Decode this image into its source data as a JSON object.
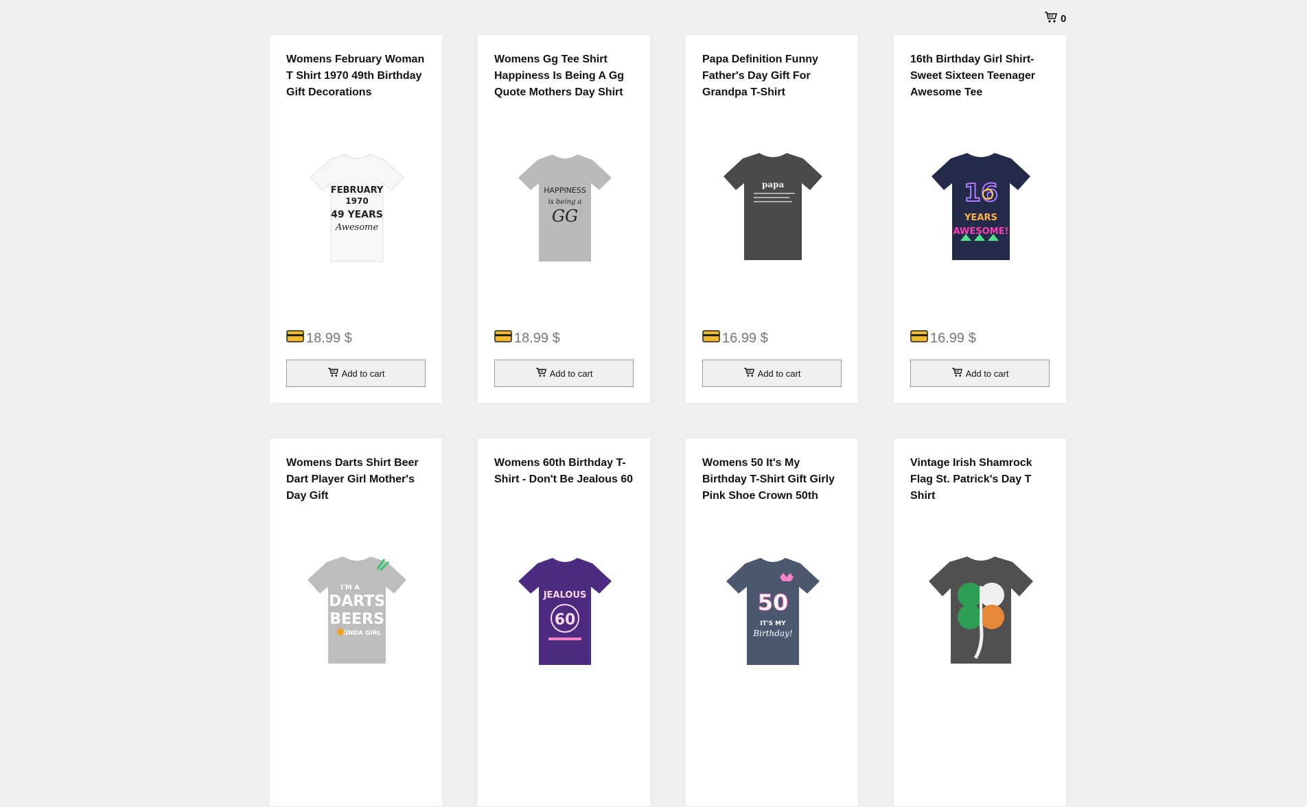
{
  "header": {
    "cart_icon": "shopping-cart-icon",
    "cart_count": "0"
  },
  "ui": {
    "currency_icon": "credit-card-icon",
    "add_to_cart_label": "Add to cart"
  },
  "products": [
    {
      "title": "Womens February Woman T Shirt 1970 49th Birthday Gift Decorations",
      "price": "18.99 $",
      "shirt_color": "#f7f7f7",
      "print_color": "#222222",
      "print_lines": [
        "FEBRUARY",
        "1970",
        "49 YEARS",
        "Awesome"
      ]
    },
    {
      "title": "Womens Gg Tee Shirt Happiness Is Being A Gg Quote Mothers Day Shirt",
      "price": "18.99 $",
      "shirt_color": "#b9b9b9",
      "print_color": "#222222",
      "print_lines": [
        "HAPPINESS",
        "is being a",
        "GG",
        ""
      ]
    },
    {
      "title": "Papa Definition Funny Father's Day Gift For Grandpa T-Shirt",
      "price": "16.99 $",
      "shirt_color": "#4a4a4c",
      "print_color": "#f2f2f2",
      "print_lines": [
        "papa",
        "",
        "",
        ""
      ]
    },
    {
      "title": "16th Birthday Girl Shirt- Sweet Sixteen Teenager Awesome Tee",
      "price": "16.99 $",
      "shirt_color": "#242a4a",
      "print_color": "#ff3fb4",
      "print_lines": [
        "16",
        "YEARS",
        "AWESOME!",
        ""
      ]
    },
    {
      "title": "Womens Darts Shirt Beer Dart Player Girl Mother's Day Gift",
      "price": "",
      "shirt_color": "#bdbdbd",
      "print_color": "#ffffff",
      "print_lines": [
        "I'M A",
        "DARTS",
        "BEERS",
        "KINDA GIRL"
      ]
    },
    {
      "title": "Womens 60th Birthday T-Shirt - Don't Be Jealous 60",
      "price": "",
      "shirt_color": "#4b2c80",
      "print_color": "#ffd7ef",
      "print_lines": [
        "JEALOUS",
        "60",
        "",
        ""
      ]
    },
    {
      "title": "Womens 50 It's My Birthday T-Shirt Gift Girly Pink Shoe Crown 50th",
      "price": "",
      "shirt_color": "#4c586e",
      "print_color": "#ff7fc8",
      "print_lines": [
        "50",
        "IT'S MY",
        "Birthday!",
        ""
      ]
    },
    {
      "title": "Vintage Irish Shamrock Flag St. Patrick's Day T Shirt",
      "price": "",
      "shirt_color": "#505050",
      "print_color": "#ffffff",
      "print_lines": [
        "",
        "",
        "",
        ""
      ]
    }
  ]
}
